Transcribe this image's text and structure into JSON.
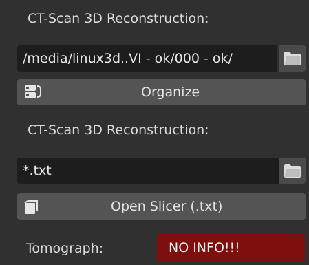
{
  "section1": {
    "title": "CT-Scan 3D Reconstruction:",
    "path_value": "/media/linux3d..VI - ok/000 - ok/",
    "folder_icon": "folder-icon",
    "button_label": "Organize",
    "button_icon": "organize-icon"
  },
  "section2": {
    "title": "CT-Scan 3D Reconstruction:",
    "path_value": "*.txt",
    "folder_icon": "folder-icon",
    "button_label": "Open Slicer (.txt)",
    "button_icon": "slicer-icon"
  },
  "tomograph": {
    "label": "Tomograph:",
    "value": "NO INFO!!!"
  },
  "colors": {
    "background": "#303030",
    "field": "#1d1d1d",
    "button": "#545454",
    "status_error": "#7d0f0f"
  }
}
